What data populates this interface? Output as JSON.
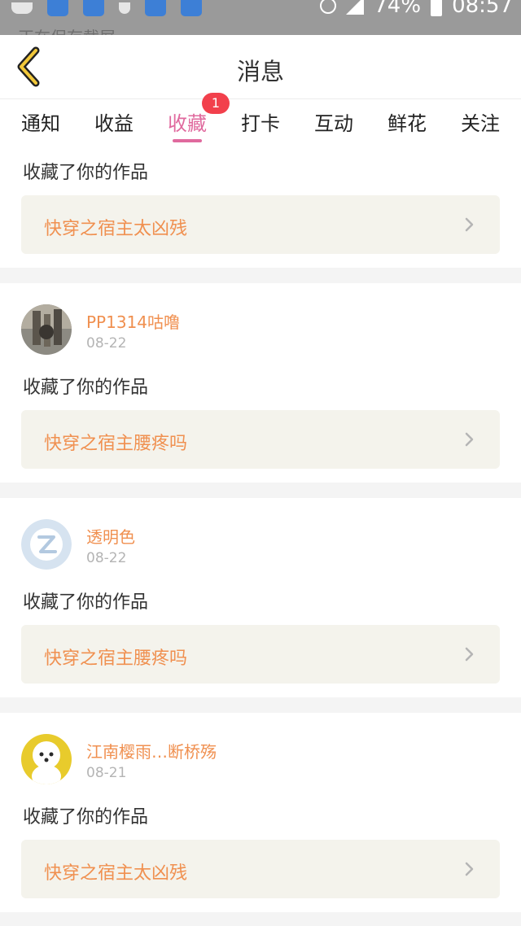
{
  "status_bar": {
    "notification": "正在保存截屏",
    "battery": "74%",
    "time": "08:57"
  },
  "header": {
    "title": "消息"
  },
  "tabs": [
    {
      "label": "通知"
    },
    {
      "label": "收益"
    },
    {
      "label": "收藏",
      "badge": "1"
    },
    {
      "label": "打卡"
    },
    {
      "label": "互动"
    },
    {
      "label": "鲜花"
    },
    {
      "label": "关注"
    }
  ],
  "active_tab_index": 2,
  "items": [
    {
      "action": "收藏了你的作品",
      "work": "快穿之宿主太凶残"
    },
    {
      "user": "PP1314咕噜",
      "date": "08-22",
      "action": "收藏了你的作品",
      "work": "快穿之宿主腰疼吗"
    },
    {
      "user": "透明色",
      "date": "08-22",
      "action": "收藏了你的作品",
      "work": "快穿之宿主腰疼吗"
    },
    {
      "user": "江南樱雨…断桥殇",
      "date": "08-21",
      "action": "收藏了你的作品",
      "work": "快穿之宿主太凶残"
    }
  ],
  "colors": {
    "accent": "#e06a9e",
    "username": "#f09050",
    "badge": "#f2404c",
    "work_box_bg": "#f4f3ec"
  }
}
